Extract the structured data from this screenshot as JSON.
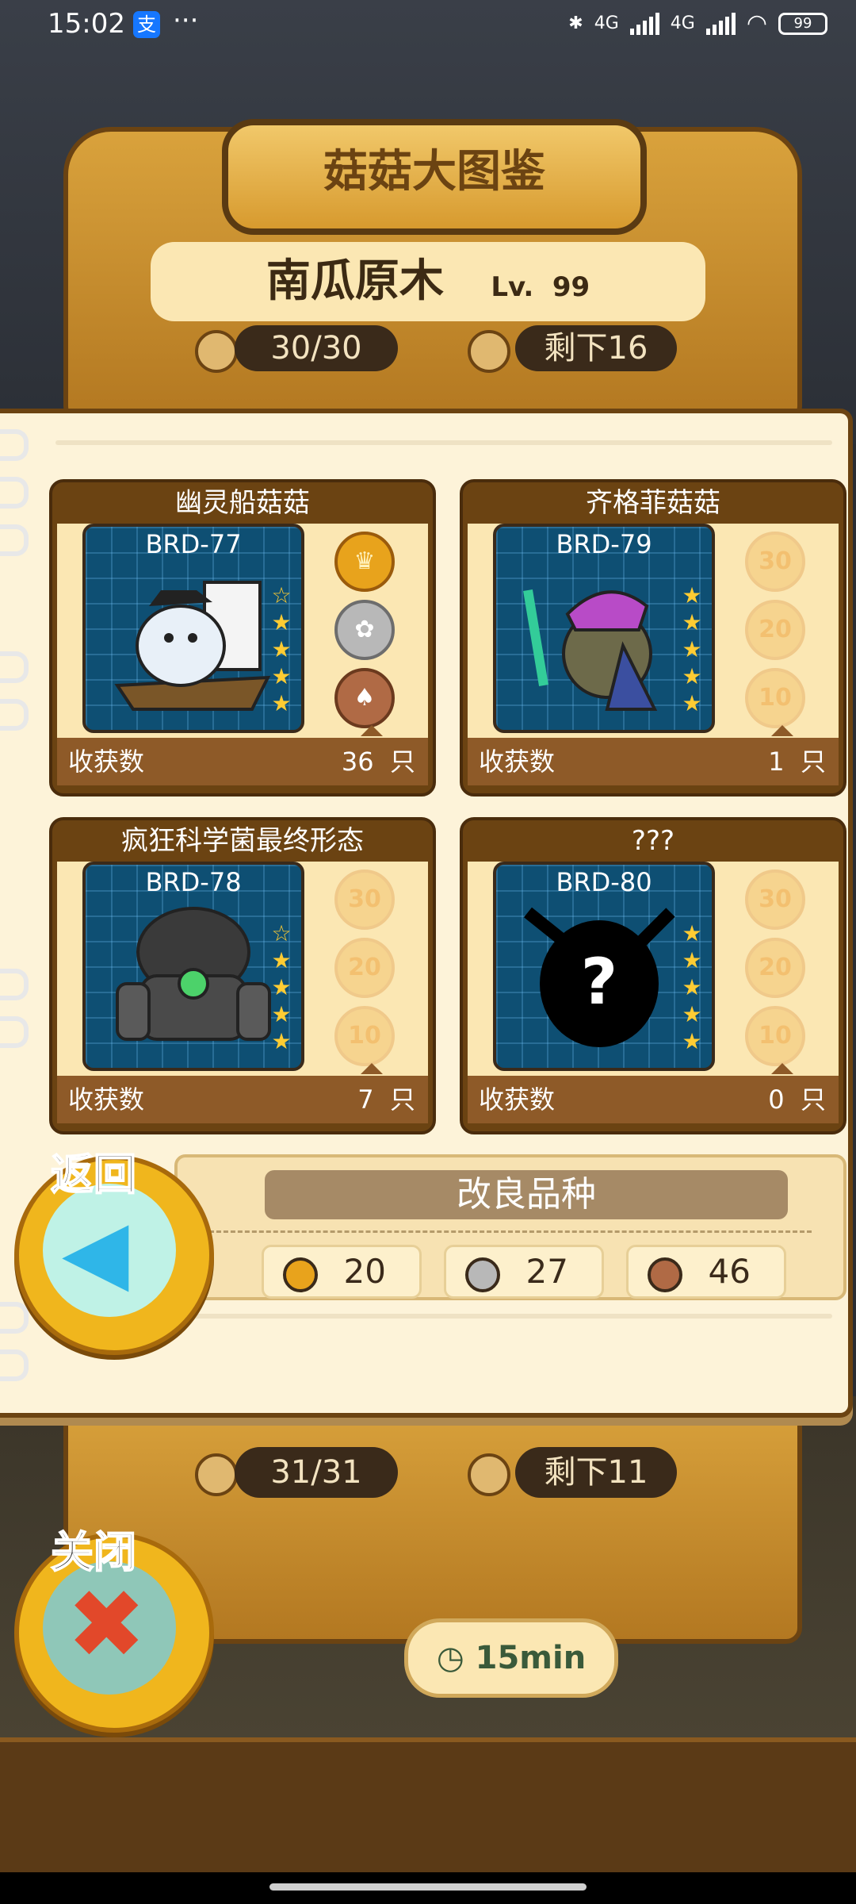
{
  "status": {
    "time": "15:02",
    "alipay_icon": "支",
    "more_icon": "···",
    "bluetooth_icon": "bluetooth-icon",
    "signal1": "4G",
    "signal2": "4G",
    "battery": "99"
  },
  "header": {
    "title": "菇菇大图鉴",
    "current_name": "南瓜原木",
    "current_level_prefix": "Lv.",
    "current_level": "99",
    "collected": "30/30",
    "remaining": "剩下16"
  },
  "cards": [
    {
      "title": "幽灵船菇菇",
      "code": "BRD-77",
      "stars_filled": 4,
      "medals": [
        {
          "type": "gold",
          "label": ""
        },
        {
          "type": "silver",
          "label": ""
        },
        {
          "type": "bronze",
          "label": ""
        }
      ],
      "footer_label": "收获数",
      "count": "36",
      "unit": "只"
    },
    {
      "title": "齐格菲菇菇",
      "code": "BRD-79",
      "stars_filled": 5,
      "medals": [
        {
          "type": "empty",
          "label": "30"
        },
        {
          "type": "empty",
          "label": "20"
        },
        {
          "type": "empty",
          "label": "10"
        }
      ],
      "footer_label": "收获数",
      "count": "1",
      "unit": "只"
    },
    {
      "title": "疯狂科学菌最终形态",
      "code": "BRD-78",
      "stars_filled": 4,
      "medals": [
        {
          "type": "empty",
          "label": "30"
        },
        {
          "type": "empty",
          "label": "20"
        },
        {
          "type": "empty",
          "label": "10"
        }
      ],
      "footer_label": "收获数",
      "count": "7",
      "unit": "只"
    },
    {
      "title": "???",
      "code": "BRD-80",
      "stars_filled": 5,
      "medals": [
        {
          "type": "empty",
          "label": "30"
        },
        {
          "type": "empty",
          "label": "20"
        },
        {
          "type": "empty",
          "label": "10"
        }
      ],
      "footer_label": "收获数",
      "count": "0",
      "unit": "只"
    }
  ],
  "improve": {
    "button_label": "改良品种",
    "gold_count": "20",
    "silver_count": "27",
    "bronze_count": "46"
  },
  "back_button": {
    "label": "返回"
  },
  "close_button": {
    "label": "关闭"
  },
  "lower": {
    "collected": "31/31",
    "remaining": "剩下11",
    "timer": "15min"
  },
  "colors": {
    "gold": "#e8a31c",
    "silver": "#b8b8b8",
    "bronze": "#b06a45",
    "card_brown": "#6b4312"
  }
}
